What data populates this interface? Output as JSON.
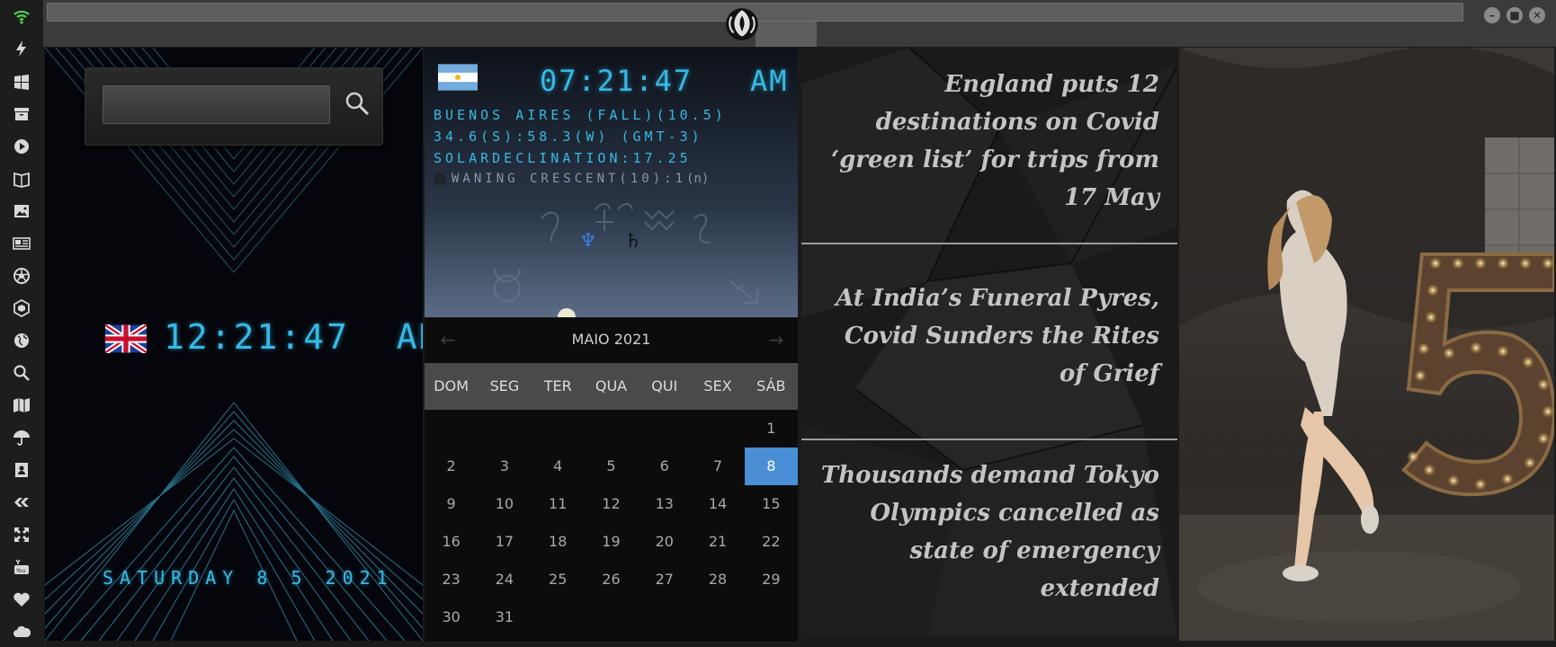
{
  "window": {
    "minimize_glyph": "–",
    "maximize_glyph": "■",
    "close_glyph": "✕"
  },
  "sidebar": {
    "icons": [
      "wifi-icon",
      "bolt-icon",
      "windows-icon",
      "archive-icon",
      "play-icon",
      "book-icon",
      "image-icon",
      "newspaper-icon",
      "aperture-icon",
      "hexagon-icon",
      "globe-icon",
      "search-icon",
      "map-icon",
      "umbrella-icon",
      "contact-icon",
      "tag-icon",
      "expand-icon",
      "youtube-icon",
      "heart-icon",
      "cloud-icon"
    ]
  },
  "clock": {
    "search_value": "",
    "time": "12:21:47",
    "ampm": "AM",
    "date": "SATURDAY 8 5 2021"
  },
  "world": {
    "time": "07:21:47",
    "ampm": "AM",
    "line1": "BUENOS AIRES (FALL)(10.5)",
    "line2": "34.6(S):58.3(W) (GMT-3)",
    "line3": "SOLARDECLINATION:17.25",
    "moon": "WANING CRESCENT(10):1",
    "moon_suffix": "(n)",
    "planet_neptune": "♆",
    "planet_saturn": "♄"
  },
  "calendar": {
    "title": "MAIO 2021",
    "prev": "←",
    "next": "→",
    "weekdays": [
      "DOM",
      "SEG",
      "TER",
      "QUA",
      "QUI",
      "SEX",
      "SÁB"
    ],
    "weeks": [
      [
        "",
        "",
        "",
        "",
        "",
        "",
        "1"
      ],
      [
        "2",
        "3",
        "4",
        "5",
        "6",
        "7",
        "8"
      ],
      [
        "9",
        "10",
        "11",
        "12",
        "13",
        "14",
        "15"
      ],
      [
        "16",
        "17",
        "18",
        "19",
        "20",
        "21",
        "22"
      ],
      [
        "23",
        "24",
        "25",
        "26",
        "27",
        "28",
        "29"
      ],
      [
        "30",
        "31",
        "",
        "",
        "",
        "",
        ""
      ]
    ],
    "selected": "8"
  },
  "news": {
    "items": [
      "England puts 12 destinations on Covid ‘green list’ for trips from 17 May",
      "At India’s Funeral Pyres, Covid Sunders the Rites of Grief",
      "Thousands demand Tokyo Olympics cancelled as state of emergency extended"
    ]
  },
  "colors": {
    "accent": "#36b9e6",
    "calendar_selected": "#4a8ed6"
  }
}
